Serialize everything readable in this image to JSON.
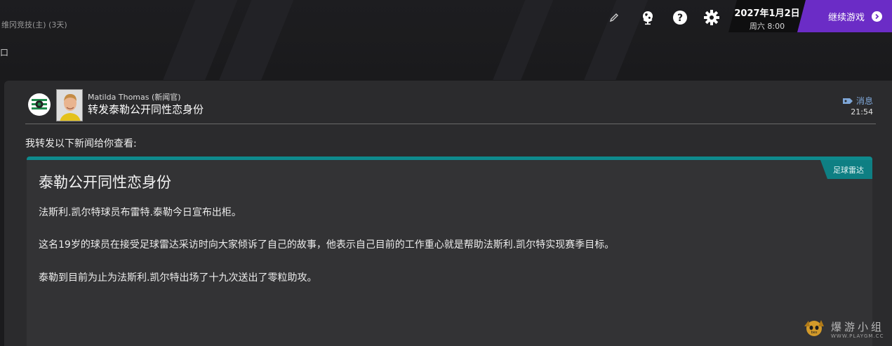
{
  "topbar": {
    "competition": "维冈竞技(主) (3天)",
    "edge_glyph": "口",
    "icons": [
      "edit-pencil-icon",
      "globe-icon",
      "help-icon",
      "settings-gear-icon"
    ],
    "date": "2027年1月2日",
    "time": "周六 8:00",
    "continue_label": "继续游戏"
  },
  "message": {
    "sender": "Matilda Thomas (新闻官)",
    "subject": "转发泰勒公开同性恋身份",
    "type_label": "消息",
    "time": "21:54",
    "intro": "我转发以下新闻给你查看:"
  },
  "news": {
    "source": "足球雷达",
    "title": "泰勒公开同性恋身份",
    "paragraphs": [
      "法斯利.凯尔特球员布雷特.泰勒今日宣布出柜。",
      "这名19岁的球员在接受足球雷达采访时向大家倾诉了自己的故事，他表示自己目前的工作重心就是帮助法斯利.凯尔特实现赛季目标。",
      "泰勒到目前为止为法斯利.凯尔特出场了十九次送出了零粒助攻。"
    ]
  },
  "watermark": {
    "text": "爆游小组",
    "url": "WWW.PLAYGM.CC"
  },
  "colors": {
    "accent_purple": "#6b2cc6",
    "news_teal": "#0e8a8d",
    "panel_bg": "#2b2b2d"
  }
}
